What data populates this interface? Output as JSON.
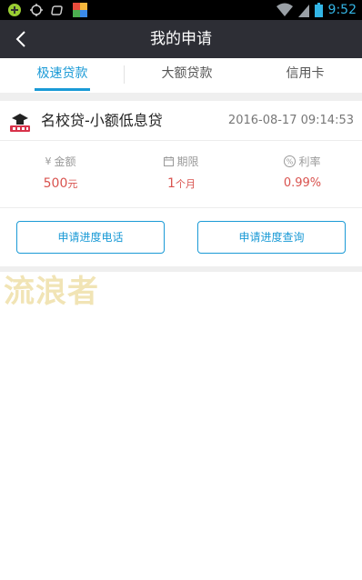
{
  "statusbar": {
    "time": "9:52",
    "icons_left": [
      "android-debug-icon",
      "gps-icon",
      "mobile-data-icon",
      "app-notification-icon"
    ],
    "icons_right": [
      "wifi-icon",
      "cell-signal-icon",
      "battery-icon"
    ]
  },
  "header": {
    "title": "我的申请",
    "back_icon": "chevron-left-icon"
  },
  "tabs": [
    {
      "label": "极速贷款",
      "active": true
    },
    {
      "label": "大额贷款",
      "active": false
    },
    {
      "label": "信用卡",
      "active": false
    }
  ],
  "application": {
    "product_name": "名校贷-小额低息贷",
    "date": "2016-08-17 09:14:53",
    "stats": [
      {
        "icon": "yen-icon",
        "label": "金额",
        "value": "500",
        "unit": "元"
      },
      {
        "icon": "calendar-icon",
        "label": "期限",
        "value": "1",
        "unit": "个月"
      },
      {
        "icon": "percent-icon",
        "label": "利率",
        "value": "0.99%",
        "unit": ""
      }
    ],
    "buttons": {
      "phone": "申请进度电话",
      "query": "申请进度查询"
    }
  },
  "watermark": "流浪者",
  "colors": {
    "accent": "#1a9ad6",
    "value_red": "#d9534f",
    "titlebar": "#2d2e35"
  }
}
